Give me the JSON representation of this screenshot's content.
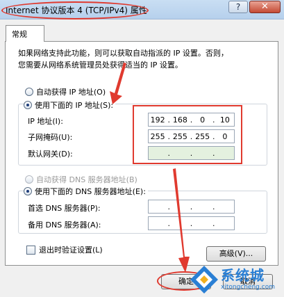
{
  "window": {
    "title": "Internet 协议版本 4 (TCP/IPv4) 属性",
    "help_label": "?",
    "close_label": "✕"
  },
  "tabs": [
    {
      "label": "常规"
    }
  ],
  "intro": {
    "line1": "如果网络支持此功能，则可以获取自动指派的 IP 设置。否则，",
    "line2": "您需要从网络系统管理员处获得适当的 IP 设置。"
  },
  "ip_section": {
    "auto_label": "自动获得 IP 地址(O)",
    "manual_label": "使用下面的 IP 地址(S):",
    "fields": [
      {
        "label": "IP 地址(I):",
        "segments": [
          "192",
          "168",
          "0",
          "10"
        ]
      },
      {
        "label": "子网掩码(U):",
        "segments": [
          "255",
          "255",
          "255",
          "0"
        ]
      },
      {
        "label": "默认网关(D):",
        "segments": [
          "",
          "",
          "",
          ""
        ]
      }
    ]
  },
  "dns_section": {
    "auto_label": "自动获得 DNS 服务器地址(B)",
    "manual_label": "使用下面的 DNS 服务器地址(E):",
    "fields": [
      {
        "label": "首选 DNS 服务器(P):",
        "segments": [
          "",
          "",
          "",
          ""
        ]
      },
      {
        "label": "备用 DNS 服务器(A):",
        "segments": [
          "",
          "",
          "",
          ""
        ]
      }
    ]
  },
  "validate_label": "退出时验证设置(L)",
  "advanced_label": "高级(V)...",
  "ok_label": "确定",
  "cancel_label": "取消",
  "watermark": {
    "name": "系统城",
    "url": "xitongcheng.com"
  },
  "colors": {
    "annotation_red": "#e03a2f",
    "titlebar": "#c9def3",
    "close_red": "#c44a34",
    "watermark_blue": "#2a7fd4"
  }
}
